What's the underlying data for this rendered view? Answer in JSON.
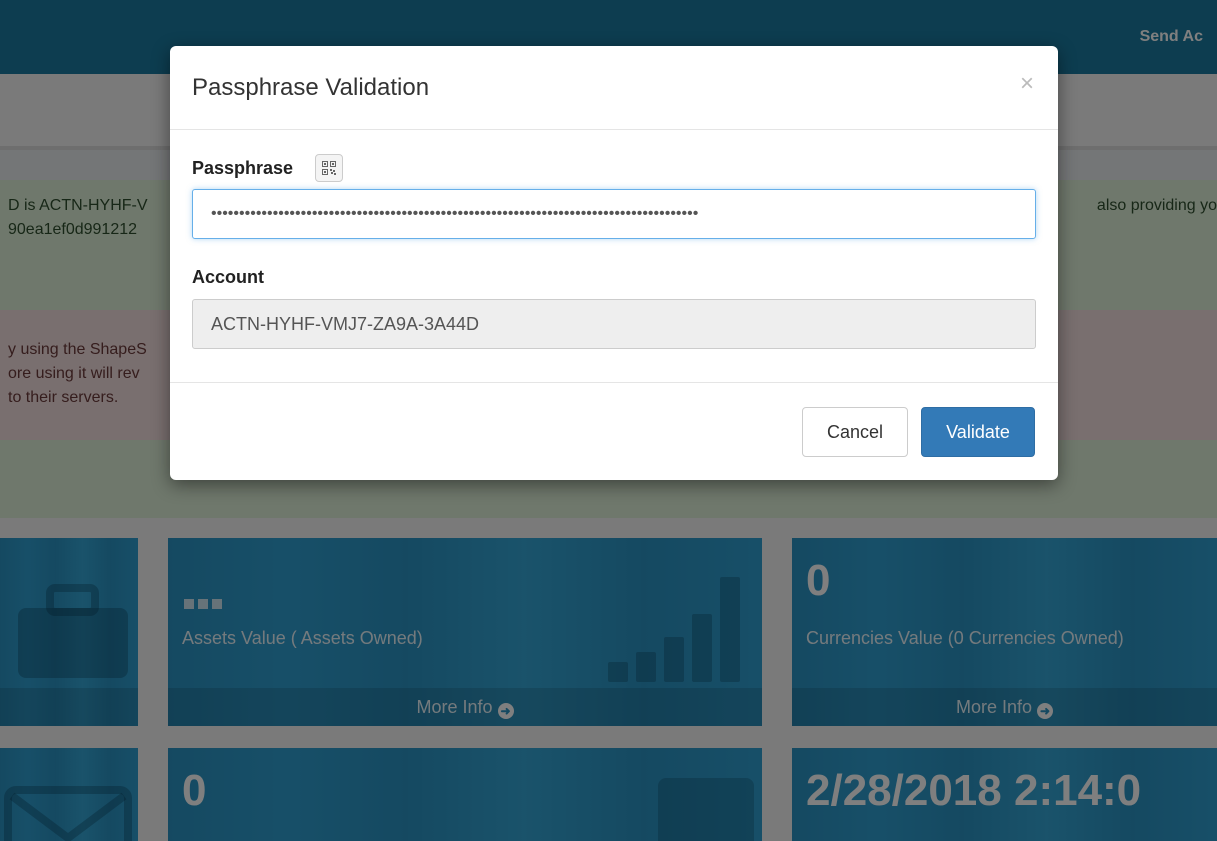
{
  "header": {
    "nav_link": "Send Ac"
  },
  "alerts": {
    "green_line1": "D is ACTN-HYHF-V",
    "green_line2": "90ea1ef0d991212",
    "green_right": "also providing yo",
    "red_line1": "y using the ShapeS",
    "red_line2": "ore using it will rev",
    "red_line3": "to their servers."
  },
  "tiles": [
    {
      "big": "",
      "sub": "",
      "footer": ""
    },
    {
      "big": "...",
      "sub": "Assets Value ( Assets Owned)",
      "footer": "More Info"
    },
    {
      "big": "0",
      "sub": "Currencies Value (0 Currencies Owned)",
      "footer": "More Info"
    },
    {
      "big": "",
      "sub": "",
      "footer": ""
    },
    {
      "big": "0",
      "sub": "",
      "footer": ""
    },
    {
      "big": "2/28/2018 2:14:0",
      "sub": "",
      "footer": ""
    }
  ],
  "modal": {
    "title": "Passphrase Validation",
    "close_glyph": "×",
    "passphrase_label": "Passphrase",
    "passphrase_value": "•••••••••••••••••••••••••••••••••••••••••••••••••••••••••••••••••••••••••••••••••••••••",
    "account_label": "Account",
    "account_value": "ACTN-HYHF-VMJ7-ZA9A-3A44D",
    "cancel_label": "Cancel",
    "validate_label": "Validate"
  },
  "icons": {
    "qr": "qr-code-icon",
    "arrow": "circle-arrow-right-icon",
    "briefcase": "briefcase-icon",
    "envelope": "envelope-icon"
  },
  "colors": {
    "primary": "#337ab7",
    "tile": "#2a93c3",
    "topbar": "#1b7aa0"
  }
}
